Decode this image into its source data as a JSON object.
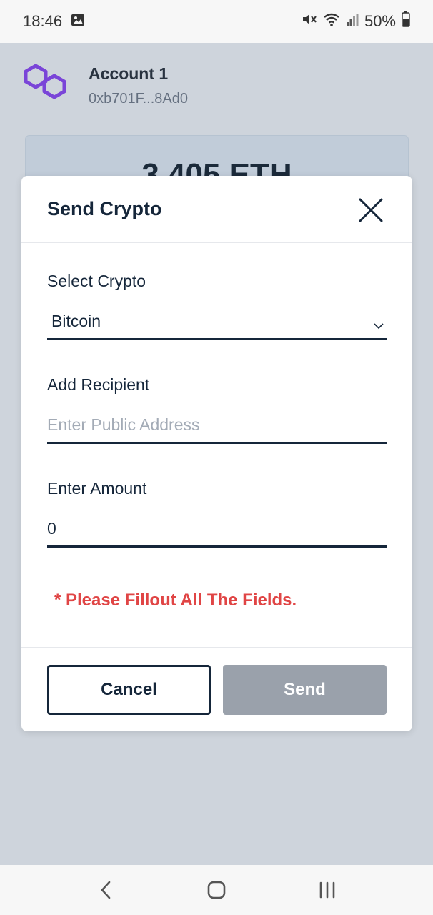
{
  "status_bar": {
    "time": "18:46",
    "battery": "50%"
  },
  "account": {
    "name": "Account 1",
    "address": "0xb701F...8Ad0",
    "balance": "3.405 ETH"
  },
  "modal": {
    "title": "Send Crypto",
    "select_label": "Select Crypto",
    "select_value": "Bitcoin",
    "recipient_label": "Add Recipient",
    "recipient_placeholder": "Enter Public Address",
    "amount_label": "Enter Amount",
    "amount_value": "0",
    "error": "* Please Fillout All The Fields.",
    "cancel_label": "Cancel",
    "send_label": "Send"
  },
  "colors": {
    "accent_logo": "#8247e5",
    "error": "#e04545",
    "send_disabled": "#9aa1ab"
  },
  "icons": [
    "image-icon",
    "mute-icon",
    "wifi-icon",
    "signal-icon",
    "battery-icon",
    "polygon-logo-icon",
    "close-icon",
    "chevron-down-icon",
    "back-icon",
    "home-icon",
    "recents-icon"
  ]
}
